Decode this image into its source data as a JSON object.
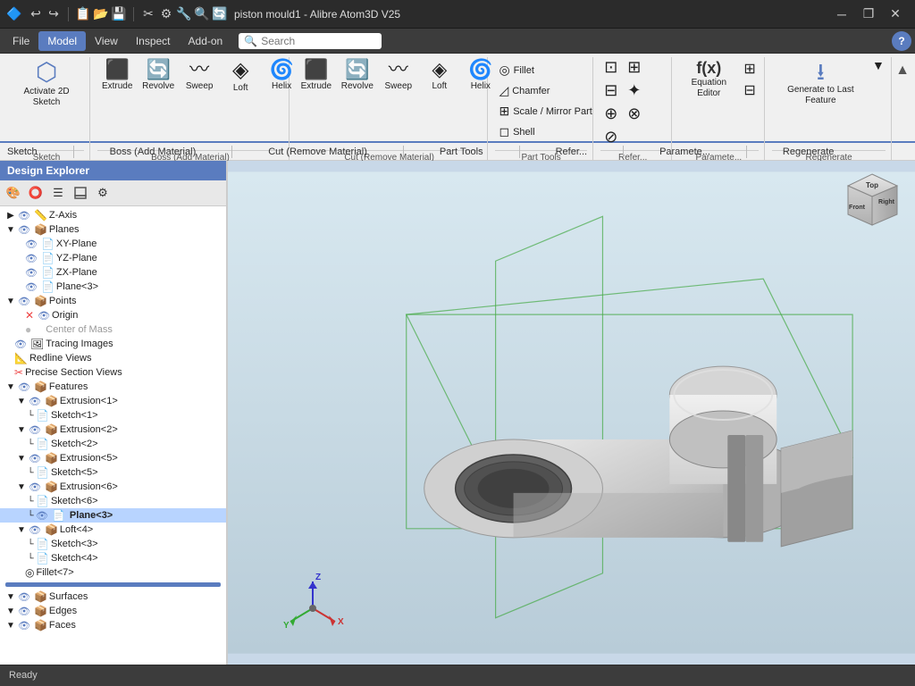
{
  "titlebar": {
    "title": "piston mould1 - Alibre Atom3D V25",
    "icons": [
      "🔷",
      "↩",
      "↪",
      "📋",
      "🗒️",
      "📄",
      "✂",
      "📐",
      "🔧",
      "🔍",
      "🔄"
    ],
    "controls": [
      "🗔",
      "❐",
      "✕"
    ]
  },
  "menubar": {
    "items": [
      "File",
      "Model",
      "View",
      "Inspect",
      "Add-on"
    ],
    "active": "Model",
    "search_placeholder": "Search",
    "help": "?"
  },
  "ribbon": {
    "boss_group": {
      "label": "Boss (Add Material)",
      "items": [
        {
          "id": "activate-sketch",
          "icon": "⬡",
          "label": "Activate\n2D Sketch"
        },
        {
          "id": "extrude-boss",
          "icon": "⬛",
          "label": "Extrude"
        },
        {
          "id": "revolve-boss",
          "icon": "🔄",
          "label": "Revolve"
        },
        {
          "id": "sweep-boss",
          "icon": "〰",
          "label": "Sweep"
        },
        {
          "id": "loft-boss",
          "icon": "◈",
          "label": "Loft"
        },
        {
          "id": "helix-boss",
          "icon": "🌀",
          "label": "Helix"
        }
      ]
    },
    "cut_group": {
      "label": "Cut (Remove Material)",
      "items": [
        {
          "id": "extrude-cut",
          "icon": "⬛",
          "label": "Extrude"
        },
        {
          "id": "revolve-cut",
          "icon": "🔄",
          "label": "Revolve"
        },
        {
          "id": "sweep-cut",
          "icon": "〰",
          "label": "Sweep"
        },
        {
          "id": "loft-cut",
          "icon": "◈",
          "label": "Loft"
        },
        {
          "id": "helix-cut",
          "icon": "🌀",
          "label": "Helix"
        }
      ]
    },
    "part_tools_group": {
      "label": "Part Tools",
      "items": [
        {
          "id": "fillet",
          "icon": "◎",
          "label": "Fillet"
        },
        {
          "id": "chamfer",
          "icon": "◿",
          "label": "Chamfer"
        },
        {
          "id": "scale-mirror",
          "icon": "⊞",
          "label": "Scale / Mirror Part"
        },
        {
          "id": "shell",
          "icon": "◻",
          "label": "Shell"
        }
      ]
    },
    "ref_group": {
      "label": "Refer...",
      "items": [
        {
          "id": "ref1",
          "icon": "⊡"
        },
        {
          "id": "ref2",
          "icon": "⊞"
        },
        {
          "id": "ref3",
          "icon": "⊟"
        },
        {
          "id": "ref4",
          "icon": "✦"
        },
        {
          "id": "ref5",
          "icon": "⊕"
        },
        {
          "id": "ref6",
          "icon": "⊗"
        },
        {
          "id": "ref7",
          "icon": "⊘"
        }
      ]
    },
    "param_group": {
      "label": "Paramete...",
      "items": [
        {
          "id": "equation-editor",
          "icon": "f(x)",
          "label": "Equation\nEditor"
        },
        {
          "id": "params",
          "icon": "⊞",
          "label": ""
        }
      ]
    },
    "regen_group": {
      "label": "Regenerate",
      "items": [
        {
          "id": "generate",
          "icon": "⭳",
          "label": "Generate to\nLast Feature"
        },
        {
          "id": "regen-down",
          "icon": "▼"
        }
      ]
    },
    "sketch_group": {
      "label": "Sketch"
    }
  },
  "design_explorer": {
    "title": "Design Explorer",
    "toolbar_buttons": [
      "🎨",
      "⭕",
      "📋",
      "📤",
      "⚙"
    ],
    "tree": [
      {
        "id": "z-axis",
        "level": 1,
        "icon": "📏",
        "eye": true,
        "label": "Z-Axis",
        "toggle": "▶"
      },
      {
        "id": "planes",
        "level": 1,
        "icon": "📦",
        "eye": true,
        "label": "Planes",
        "toggle": "▼"
      },
      {
        "id": "xy-plane",
        "level": 2,
        "icon": "📄",
        "eye": true,
        "label": "XY-Plane",
        "toggle": null
      },
      {
        "id": "yz-plane",
        "level": 2,
        "icon": "📄",
        "eye": true,
        "label": "YZ-Plane",
        "toggle": null
      },
      {
        "id": "zx-plane",
        "level": 2,
        "icon": "📄",
        "eye": true,
        "label": "ZX-Plane",
        "toggle": null
      },
      {
        "id": "plane3",
        "level": 2,
        "icon": "📄",
        "eye": true,
        "label": "Plane<3>",
        "toggle": null
      },
      {
        "id": "points",
        "level": 1,
        "icon": "📦",
        "eye": true,
        "label": "Points",
        "toggle": "▼"
      },
      {
        "id": "origin",
        "level": 2,
        "icon": "✕",
        "eye": true,
        "label": "Origin",
        "toggle": null
      },
      {
        "id": "center-of-mass",
        "level": 2,
        "icon": "●",
        "eye": false,
        "label": "Center of Mass",
        "toggle": null,
        "muted": true
      },
      {
        "id": "tracing-images",
        "level": 1,
        "icon": "🖼",
        "eye": true,
        "label": "Tracing Images",
        "toggle": null
      },
      {
        "id": "redline-views",
        "level": 1,
        "icon": "📐",
        "eye": false,
        "label": "Redline Views",
        "toggle": null
      },
      {
        "id": "precise-section-views",
        "level": 1,
        "icon": "✂",
        "eye": false,
        "label": "Precise Section Views",
        "toggle": null
      },
      {
        "id": "features",
        "level": 1,
        "icon": "📦",
        "eye": true,
        "label": "Features",
        "toggle": "▼"
      },
      {
        "id": "extrusion1",
        "level": 2,
        "icon": "📦",
        "eye": true,
        "label": "Extrusion<1>",
        "toggle": "▼"
      },
      {
        "id": "sketch1",
        "level": 3,
        "icon": "📄",
        "eye": true,
        "label": "Sketch<1>",
        "toggle": null
      },
      {
        "id": "extrusion2",
        "level": 2,
        "icon": "📦",
        "eye": true,
        "label": "Extrusion<2>",
        "toggle": "▼"
      },
      {
        "id": "sketch2",
        "level": 3,
        "icon": "📄",
        "eye": true,
        "label": "Sketch<2>",
        "toggle": null
      },
      {
        "id": "extrusion5",
        "level": 2,
        "icon": "📦",
        "eye": true,
        "label": "Extrusion<5>",
        "toggle": "▼"
      },
      {
        "id": "sketch5",
        "level": 3,
        "icon": "📄",
        "eye": true,
        "label": "Sketch<5>",
        "toggle": null
      },
      {
        "id": "extrusion6",
        "level": 2,
        "icon": "📦",
        "eye": true,
        "label": "Extrusion<6>",
        "toggle": "▼"
      },
      {
        "id": "sketch6",
        "level": 3,
        "icon": "📄",
        "eye": true,
        "label": "Sketch<6>",
        "toggle": null
      },
      {
        "id": "plane3b",
        "level": 3,
        "icon": "📄",
        "eye": true,
        "label": "Plane<3>",
        "toggle": null,
        "selected": true
      },
      {
        "id": "loft4",
        "level": 2,
        "icon": "📦",
        "eye": true,
        "label": "Loft<4>",
        "toggle": "▼"
      },
      {
        "id": "sketch3",
        "level": 3,
        "icon": "📄",
        "eye": false,
        "label": "Sketch<3>",
        "toggle": null
      },
      {
        "id": "sketch4",
        "level": 3,
        "icon": "📄",
        "eye": false,
        "label": "Sketch<4>",
        "toggle": null
      },
      {
        "id": "fillet7",
        "level": 2,
        "icon": "◎",
        "eye": false,
        "label": "Fillet<7>",
        "toggle": null
      },
      {
        "id": "progress-indicator",
        "level": 2,
        "icon": null,
        "label": "",
        "special": "progress"
      },
      {
        "id": "surfaces",
        "level": 1,
        "icon": "📦",
        "eye": true,
        "label": "Surfaces",
        "toggle": "▼"
      },
      {
        "id": "edges",
        "level": 1,
        "icon": "📦",
        "eye": true,
        "label": "Edges",
        "toggle": "▼"
      },
      {
        "id": "faces",
        "level": 1,
        "icon": "📦",
        "eye": true,
        "label": "Faces",
        "toggle": "▼"
      }
    ]
  },
  "statusbar": {
    "text": "Ready"
  },
  "viewport": {
    "cube_faces": [
      "Top",
      "Front",
      "Right"
    ],
    "axes": {
      "x": "X",
      "y": "Y",
      "z": "Z"
    }
  },
  "ribbon_bottom_labels": [
    "Sketch",
    "Boss (Add Material)",
    "Cut (Remove Material)",
    "Part Tools",
    "Refer...",
    "Paramete...",
    "Regenerate"
  ]
}
